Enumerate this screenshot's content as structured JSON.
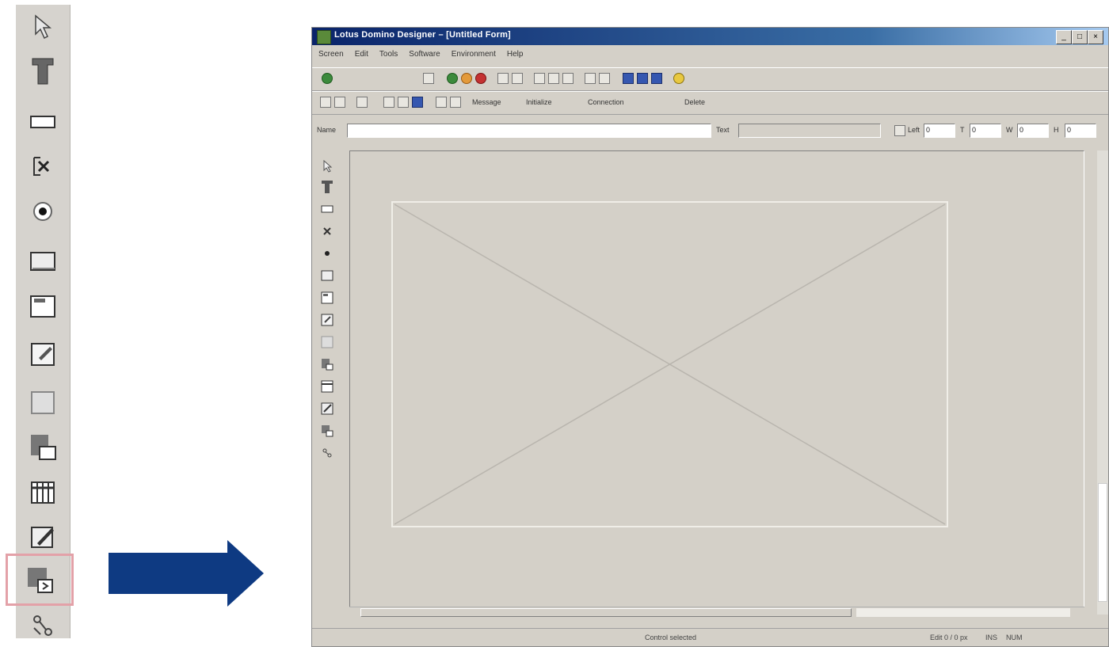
{
  "toolbox": {
    "tools": [
      "select-pointer-icon",
      "text-icon",
      "input-field-icon",
      "checkbox-icon",
      "radio-button-icon",
      "button-icon",
      "frame-icon",
      "edit-image-icon",
      "panel-icon",
      "image-button-icon",
      "table-icon",
      "image-edit-icon",
      "image-control-icon",
      "connector-icon"
    ],
    "highlight_color": "#e3a1a8"
  },
  "arrow": {
    "color": "#0e3a82"
  },
  "window": {
    "title": "Lotus Domino Designer – [Untitled Form]",
    "controls": [
      "_",
      "□",
      "×"
    ],
    "menu": [
      "Screen",
      "Edit",
      "Tools",
      "Software",
      "Environment",
      "Help"
    ],
    "toolbar2": {
      "message_label": "Message",
      "initialize_label": "Initialize",
      "connection_label": "Connection",
      "delete_label": "Delete"
    },
    "properties": {
      "name_label": "Name",
      "name_value": "",
      "text_label": "Text",
      "text_value": "",
      "fields": [
        {
          "label": "Left",
          "value": "0"
        },
        {
          "label": "T",
          "value": "0"
        },
        {
          "label": "W",
          "value": "0"
        },
        {
          "label": "H",
          "value": "0"
        }
      ]
    },
    "status": {
      "center": "Control selected",
      "right_a": "Edit 0 / 0 px",
      "right_b": "INS",
      "right_c": "NUM"
    }
  }
}
